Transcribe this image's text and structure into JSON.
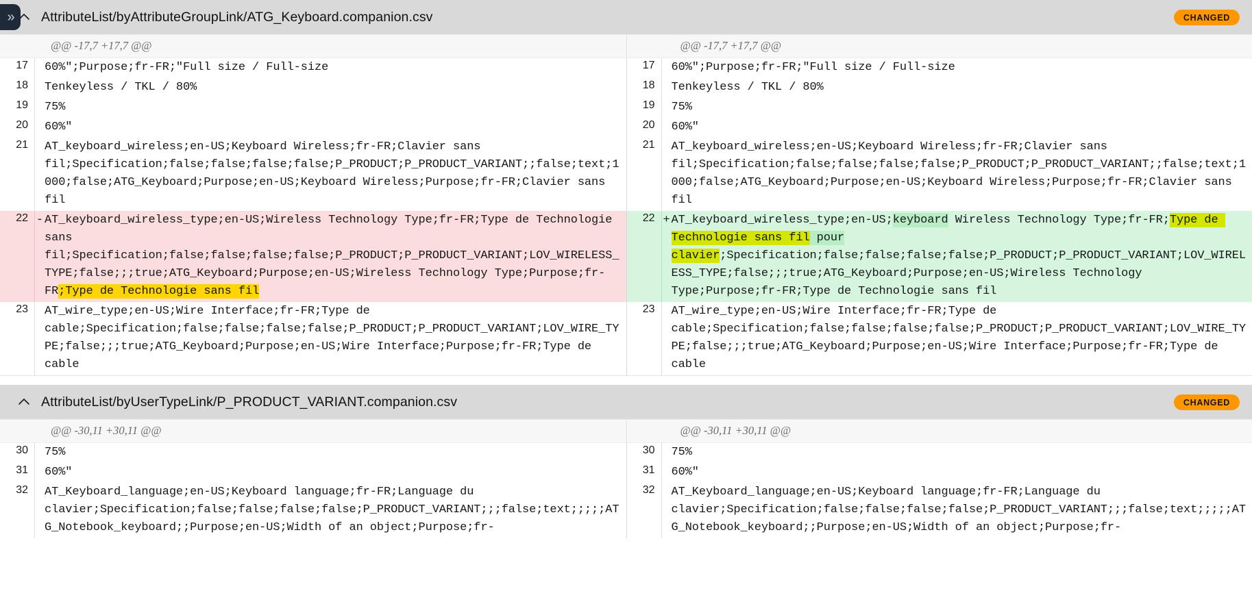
{
  "rail": {
    "toggle_glyph": "»"
  },
  "files": [
    {
      "id": "file1",
      "title": "AttributeList/byAttributeGroupLink/ATG_Keyboard.companion.csv",
      "badge": "CHANGED",
      "hunk_left": "@@ -17,7 +17,7 @@",
      "hunk_right": "@@ -17,7 +17,7 @@",
      "rows": [
        {
          "type": "ctx",
          "left_num": "17",
          "right_num": "17",
          "left_marker": "",
          "right_marker": "",
          "left_text": "60%\";Purpose;fr-FR;\"Full size / Full-size",
          "right_text": "60%\";Purpose;fr-FR;\"Full size / Full-size"
        },
        {
          "type": "ctx",
          "left_num": "18",
          "right_num": "18",
          "left_marker": "",
          "right_marker": "",
          "left_text": "Tenkeyless / TKL / 80%",
          "right_text": "Tenkeyless / TKL / 80%"
        },
        {
          "type": "ctx",
          "left_num": "19",
          "right_num": "19",
          "left_marker": "",
          "right_marker": "",
          "left_text": "75%",
          "right_text": "75%"
        },
        {
          "type": "ctx",
          "left_num": "20",
          "right_num": "20",
          "left_marker": "",
          "right_marker": "",
          "left_text": "60%\"",
          "right_text": "60%\""
        },
        {
          "type": "ctx",
          "left_num": "21",
          "right_num": "21",
          "left_marker": "",
          "right_marker": "",
          "left_text": "AT_keyboard_wireless;en-US;Keyboard Wireless;fr-FR;Clavier sans fil;Specification;false;false;false;false;P_PRODUCT;P_PRODUCT_VARIANT;;false;text;1000;false;ATG_Keyboard;Purpose;en-US;Keyboard Wireless;Purpose;fr-FR;Clavier sans fil",
          "right_text": "AT_keyboard_wireless;en-US;Keyboard Wireless;fr-FR;Clavier sans fil;Specification;false;false;false;false;P_PRODUCT;P_PRODUCT_VARIANT;;false;text;1000;false;ATG_Keyboard;Purpose;en-US;Keyboard Wireless;Purpose;fr-FR;Clavier sans fil"
        },
        {
          "type": "change",
          "left_num": "22",
          "right_num": "22",
          "left_marker": "-",
          "right_marker": "+",
          "left_segments": [
            {
              "text": "AT_keyboard_wireless_type;en-US;Wireless Technology Type;fr-FR;Type de Technologie sans fil;Specification;false;false;false;false;P_PRODUCT;P_PRODUCT_VARIANT;LOV_WIRELESS_TYPE;false;;;true;ATG_Keyboard;Purpose;en-US;Wireless Technology Type;Purpose;fr-FR",
              "hl": "none"
            },
            {
              "text": ";Type de Technologie sans fil",
              "hl": "del"
            }
          ],
          "right_segments": [
            {
              "text": "AT_keyboard_wireless_type;en-US;",
              "hl": "none"
            },
            {
              "text": "keyboard",
              "hl": "add-soft"
            },
            {
              "text": " Wireless Technology Type;fr-FR;",
              "hl": "none"
            },
            {
              "text": "Type de Technologie sans fil",
              "hl": "add"
            },
            {
              "text": " pour",
              "hl": "add-soft"
            },
            {
              "text": " ",
              "hl": "none"
            },
            {
              "text": "clavier",
              "hl": "add"
            },
            {
              "text": ";Specification;false;false;false;false;P_PRODUCT;P_PRODUCT_VARIANT;LOV_WIRELESS_TYPE;false;;;true;ATG_Keyboard;Purpose;en-US;Wireless Technology Type;Purpose;fr-FR;Type de Technologie sans fil",
              "hl": "none"
            }
          ]
        },
        {
          "type": "ctx",
          "left_num": "23",
          "right_num": "23",
          "left_marker": "",
          "right_marker": "",
          "left_text": "AT_wire_type;en-US;Wire Interface;fr-FR;Type de cable;Specification;false;false;false;false;P_PRODUCT;P_PRODUCT_VARIANT;LOV_WIRE_TYPE;false;;;true;ATG_Keyboard;Purpose;en-US;Wire Interface;Purpose;fr-FR;Type de cable",
          "right_text": "AT_wire_type;en-US;Wire Interface;fr-FR;Type de cable;Specification;false;false;false;false;P_PRODUCT;P_PRODUCT_VARIANT;LOV_WIRE_TYPE;false;;;true;ATG_Keyboard;Purpose;en-US;Wire Interface;Purpose;fr-FR;Type de cable"
        }
      ]
    },
    {
      "id": "file2",
      "title": "AttributeList/byUserTypeLink/P_PRODUCT_VARIANT.companion.csv",
      "badge": "CHANGED",
      "hunk_left": "@@ -30,11 +30,11 @@",
      "hunk_right": "@@ -30,11 +30,11 @@",
      "rows": [
        {
          "type": "ctx",
          "left_num": "30",
          "right_num": "30",
          "left_marker": "",
          "right_marker": "",
          "left_text": "75%",
          "right_text": "75%"
        },
        {
          "type": "ctx",
          "left_num": "31",
          "right_num": "31",
          "left_marker": "",
          "right_marker": "",
          "left_text": "60%\"",
          "right_text": "60%\""
        },
        {
          "type": "ctx",
          "left_num": "32",
          "right_num": "32",
          "left_marker": "",
          "right_marker": "",
          "left_text": "AT_Keyboard_language;en-US;Keyboard language;fr-FR;Language du clavier;Specification;false;false;false;false;P_PRODUCT_VARIANT;;;false;text;;;;;ATG_Notebook_keyboard;;Purpose;en-US;Width of an object;Purpose;fr-",
          "right_text": "AT_Keyboard_language;en-US;Keyboard language;fr-FR;Language du clavier;Specification;false;false;false;false;P_PRODUCT_VARIANT;;;false;text;;;;;ATG_Notebook_keyboard;;Purpose;en-US;Width of an object;Purpose;fr-"
        }
      ]
    }
  ],
  "colors": {
    "badge_bg": "#ff9800",
    "header_bg": "#d9d9d9",
    "deleted_bg": "#fbdddd",
    "added_bg": "#d6f5de",
    "highlight_deleted": "#ffd500",
    "highlight_added": "#d4e600",
    "highlight_added_soft": "#b9eec5"
  }
}
